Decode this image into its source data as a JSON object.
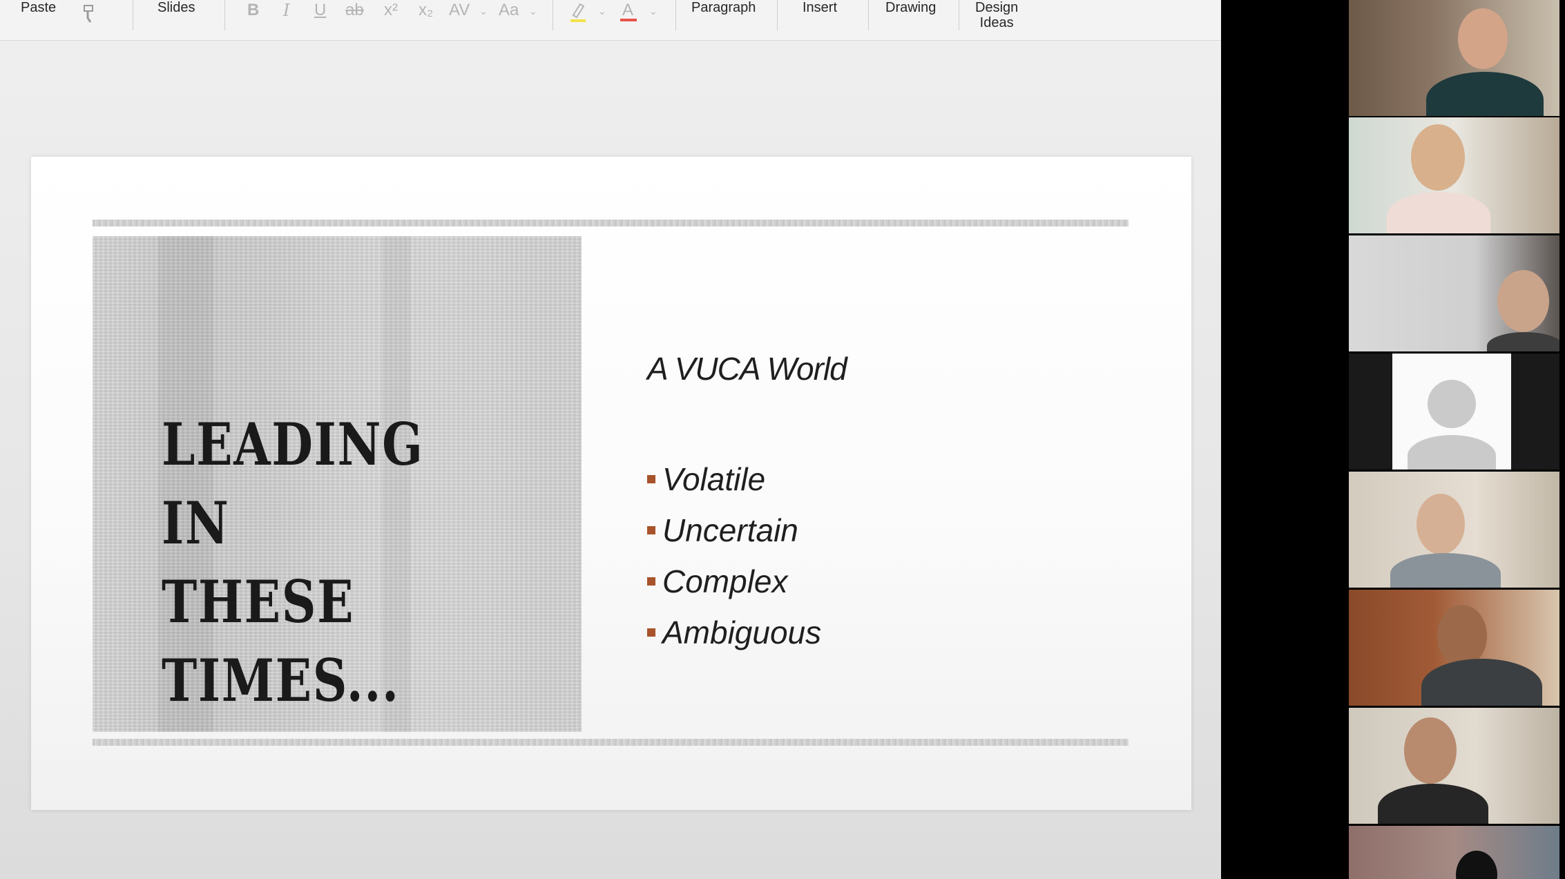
{
  "ribbon": {
    "paste": "Paste",
    "slides": "Slides",
    "bold": "B",
    "italic": "I",
    "underline": "U",
    "strike": "ab",
    "superscript": "x²",
    "subscript": "x₂",
    "spacing": "AV",
    "case": "Aa",
    "highlight_color": "#f3e24a",
    "font_color": "#e8534a",
    "paragraph": "Paragraph",
    "insert": "Insert",
    "drawing": "Drawing",
    "design_ideas": "Design\nIdeas"
  },
  "slide": {
    "title": "LEADING IN\nTHESE\nTIMES...",
    "subtitle": "A VUCA World",
    "bullets": [
      "Volatile",
      "Uncertain",
      "Complex",
      "Ambiguous"
    ],
    "bullet_color": "#a8532b"
  },
  "participants": [
    {
      "id": "p1",
      "kind": "video"
    },
    {
      "id": "p2",
      "kind": "video"
    },
    {
      "id": "p3",
      "kind": "video"
    },
    {
      "id": "p4",
      "kind": "avatar"
    },
    {
      "id": "p5",
      "kind": "video"
    },
    {
      "id": "p6",
      "kind": "video"
    },
    {
      "id": "p7",
      "kind": "video"
    },
    {
      "id": "p8",
      "kind": "video"
    }
  ]
}
